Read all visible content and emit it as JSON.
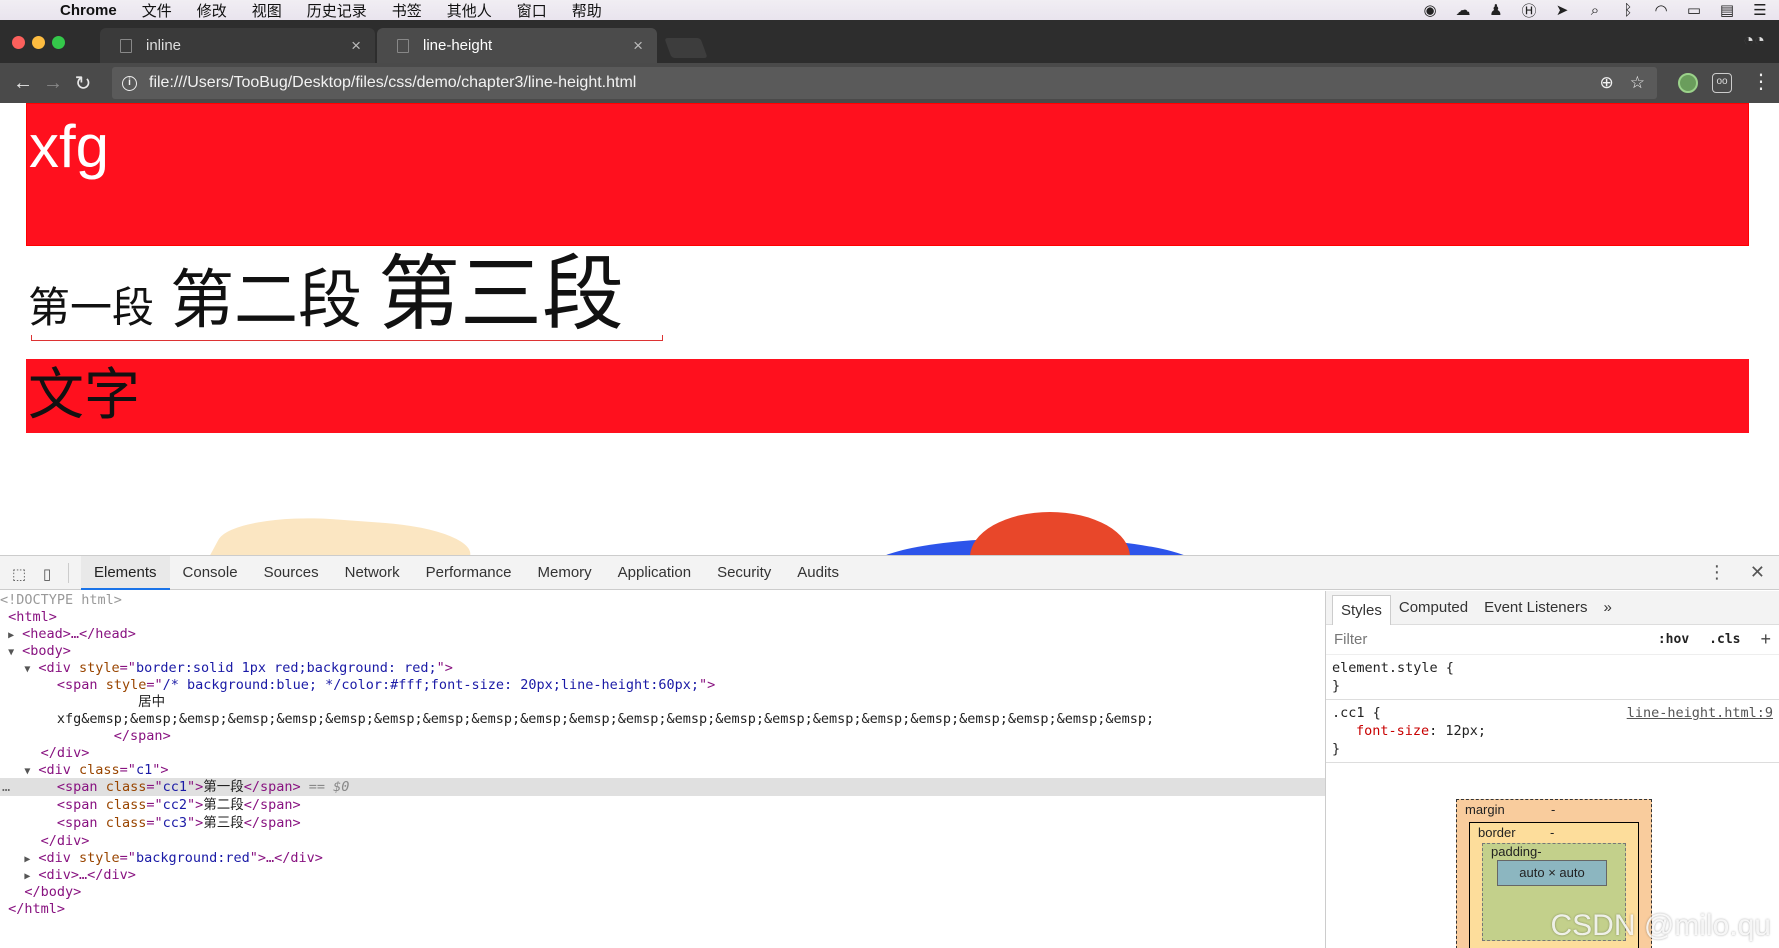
{
  "menubar": {
    "app": "Chrome",
    "items": [
      "文件",
      "修改",
      "视图",
      "历史记录",
      "书签",
      "其他人",
      "窗口",
      "帮助"
    ]
  },
  "tabs": [
    {
      "title": "inline",
      "active": false
    },
    {
      "title": "line-height",
      "active": true
    }
  ],
  "toolbar": {
    "url": "file:///Users/TooBug/Desktop/files/css/demo/chapter3/line-height.html"
  },
  "page": {
    "block1_text": "xfg",
    "cc1": "第一段",
    "cc2": "第二段",
    "cc3": "第三段",
    "block3_text": "文字"
  },
  "devtools": {
    "tabs": [
      "Elements",
      "Console",
      "Sources",
      "Network",
      "Performance",
      "Memory",
      "Application",
      "Security",
      "Audits"
    ],
    "active_tab": "Elements",
    "dom": {
      "doctype": "<!DOCTYPE html>",
      "html_open": "<html>",
      "head": "<head>…</head>",
      "body_open": "<body>",
      "div1_style": "border:solid 1px red;background: red;",
      "span1_style": "/* background:blue; */color:#fff;font-size: 20px;line-height:60px;",
      "span1_text1": "居中",
      "span1_text2": "xfg&emsp;&emsp;&emsp;&emsp;&emsp;&emsp;&emsp;&emsp;&emsp;&emsp;&emsp;&emsp;&emsp;&emsp;&emsp;&emsp;&emsp;&emsp;&emsp;&emsp;&emsp;&emsp;",
      "span_close": "</span>",
      "div_close": "</div>",
      "div2_class": "c1",
      "cc1_class": "cc1",
      "cc1_text": "第一段",
      "selected_marker": "== $0",
      "cc2_class": "cc2",
      "cc2_text": "第二段",
      "cc3_class": "cc3",
      "cc3_text": "第三段",
      "div3_style": "background:red",
      "div3_rest": "…</div>",
      "div4": "<div>…</div>",
      "body_close": "</body>",
      "html_close": "</html>"
    },
    "styles": {
      "tabs": [
        "Styles",
        "Computed",
        "Event Listeners"
      ],
      "filter_placeholder": "Filter",
      "hov": ":hov",
      "cls": ".cls",
      "element_style": "element.style {",
      "rule_selector": ".cc1 {",
      "rule_source": "line-height.html:9",
      "rule_prop": "font-size",
      "rule_value": "12px;",
      "close_brace": "}"
    },
    "boxmodel": {
      "margin": "margin",
      "border": "border",
      "padding": "padding-",
      "content": "auto × auto",
      "dash": "-"
    }
  },
  "watermark": "CSDN @milo.qu"
}
